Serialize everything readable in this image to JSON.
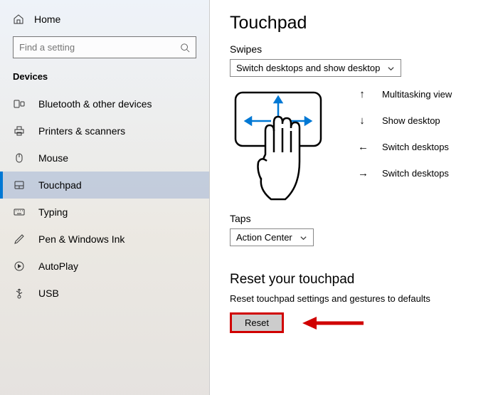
{
  "sidebar": {
    "home": "Home",
    "search_placeholder": "Find a setting",
    "section": "Devices",
    "items": [
      {
        "label": "Bluetooth & other devices",
        "icon": "bluetooth"
      },
      {
        "label": "Printers & scanners",
        "icon": "printer"
      },
      {
        "label": "Mouse",
        "icon": "mouse"
      },
      {
        "label": "Touchpad",
        "icon": "touchpad",
        "selected": true
      },
      {
        "label": "Typing",
        "icon": "keyboard"
      },
      {
        "label": "Pen & Windows Ink",
        "icon": "pen"
      },
      {
        "label": "AutoPlay",
        "icon": "autoplay"
      },
      {
        "label": "USB",
        "icon": "usb"
      }
    ]
  },
  "main": {
    "title": "Touchpad",
    "swipes_label": "Swipes",
    "swipes_value": "Switch desktops and show desktop",
    "gestures": [
      {
        "arrow": "↑",
        "label": "Multitasking view"
      },
      {
        "arrow": "↓",
        "label": "Show desktop"
      },
      {
        "arrow": "←",
        "label": "Switch desktops"
      },
      {
        "arrow": "→",
        "label": "Switch desktops"
      }
    ],
    "taps_label": "Taps",
    "taps_value": "Action Center",
    "reset_title": "Reset your touchpad",
    "reset_desc": "Reset touchpad settings and gestures to defaults",
    "reset_button": "Reset"
  }
}
